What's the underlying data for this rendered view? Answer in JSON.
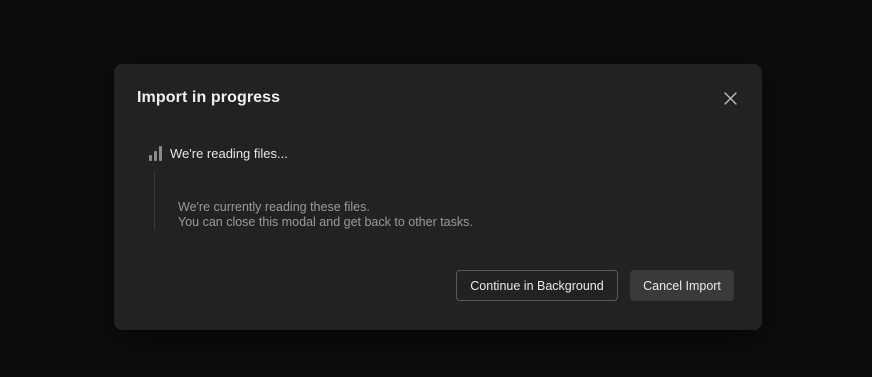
{
  "modal": {
    "title": "Import in progress",
    "close_icon": "close-icon",
    "status": {
      "icon": "loading-bars-icon",
      "text": "We're reading files..."
    },
    "description": [
      "We're currently reading these files.",
      "You can close this modal and get back to other tasks."
    ],
    "buttons": {
      "continue_label": "Continue in Background",
      "cancel_label": "Cancel Import"
    }
  },
  "colors": {
    "backdrop": "#0d0d0d",
    "modal_bg": "#222222",
    "title": "#f0f0f0",
    "muted_text": "#9a9a9a",
    "button_filled": "#3a3a3a",
    "button_border": "#5a5a5a"
  }
}
